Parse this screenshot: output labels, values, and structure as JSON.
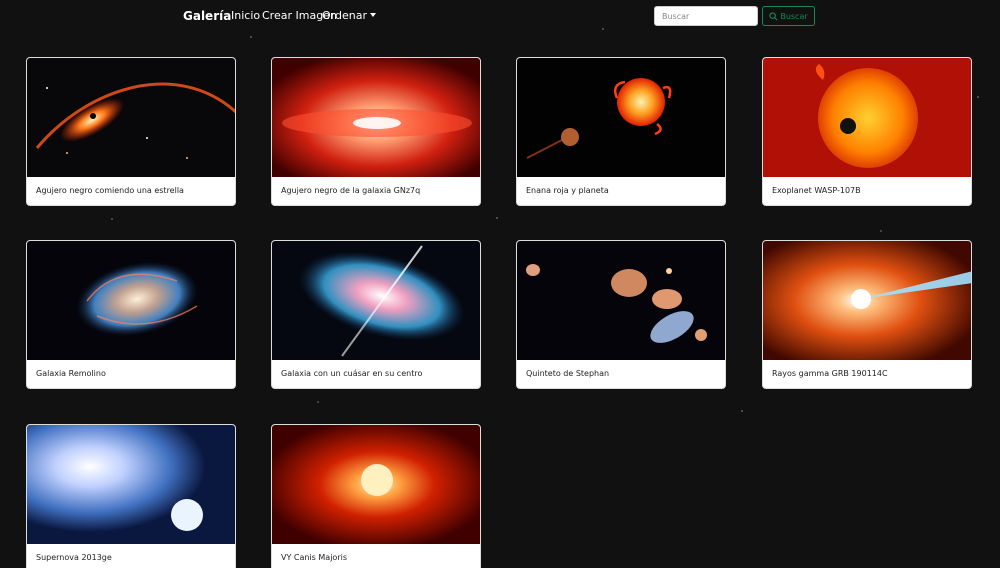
{
  "nav": {
    "brand": "Galería",
    "inicio": "Inicio",
    "crear": "Crear Imagen",
    "ordenar": "Ordenar",
    "search_placeholder": "Buscar",
    "search_button": "Buscar"
  },
  "colors": {
    "accent": "#198754",
    "background": "#111111",
    "card": "#ffffff"
  },
  "cards": [
    {
      "title": "Agujero negro comiendo una estrella"
    },
    {
      "title": "Agujero negro de la galaxia GNz7q"
    },
    {
      "title": "Enana roja y planeta"
    },
    {
      "title": "Exoplanet WASP-107B"
    },
    {
      "title": "Galaxia Remolino"
    },
    {
      "title": "Galaxia con un cuásar en su centro"
    },
    {
      "title": "Quinteto de Stephan"
    },
    {
      "title": "Rayos gamma GRB 190114C"
    },
    {
      "title": "Supernova 2013ge"
    },
    {
      "title": "VY Canis Majoris"
    }
  ]
}
